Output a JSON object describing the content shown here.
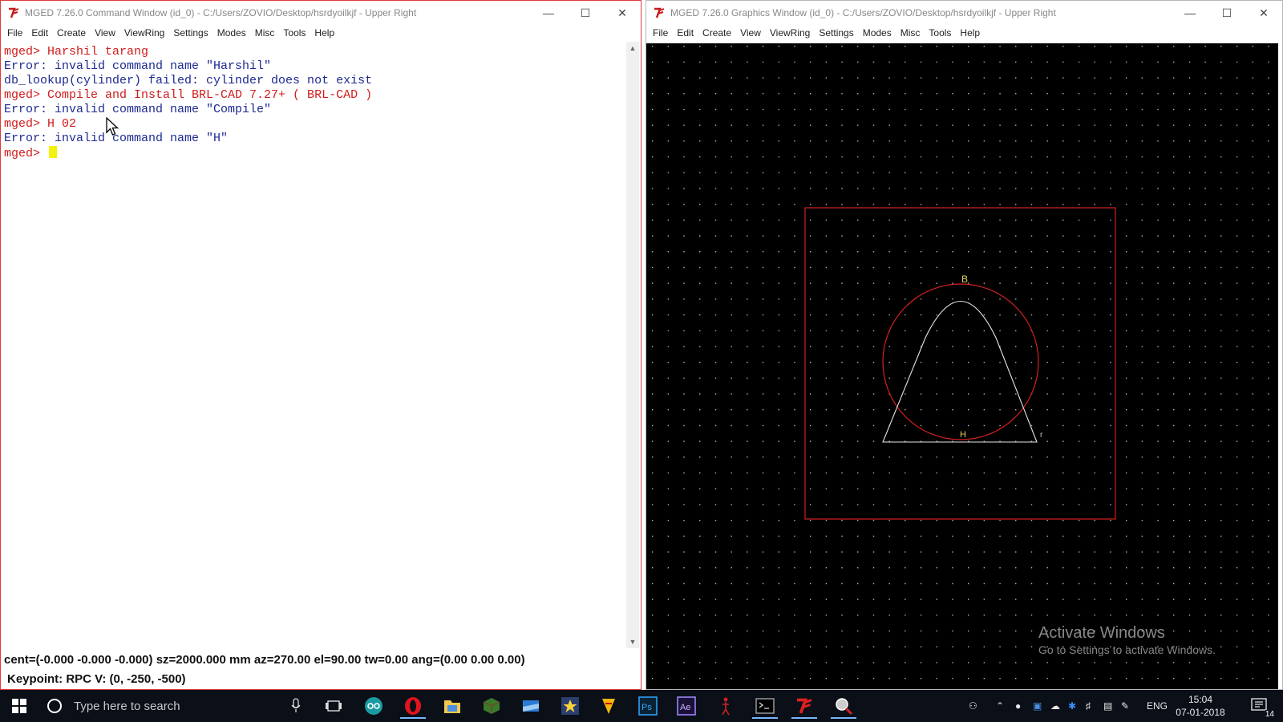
{
  "cmd_window": {
    "title": "MGED 7.26.0 Command Window (id_0) - C:/Users/ZOVIO/Desktop/hsrdyoilkjf - Upper Right",
    "menu": [
      "File",
      "Edit",
      "Create",
      "View",
      "ViewRing",
      "Settings",
      "Modes",
      "Misc",
      "Tools",
      "Help"
    ],
    "lines": [
      {
        "type": "prompt",
        "text": "mged> Harshil tarang"
      },
      {
        "type": "out",
        "text": "Error: invalid command name \"Harshil\""
      },
      {
        "type": "out",
        "text": "db_lookup(cylinder) failed: cylinder does not exist"
      },
      {
        "type": "prompt",
        "text": "mged> Compile and Install BRL-CAD 7.27+ ( BRL-CAD )"
      },
      {
        "type": "out",
        "text": "Error: invalid command name \"Compile\""
      },
      {
        "type": "prompt",
        "text": "mged> H 02"
      },
      {
        "type": "out",
        "text": "Error: invalid command name \"H\""
      }
    ],
    "current_prompt": "mged> ",
    "status_line1": "cent=(-0.000 -0.000 -0.000) sz=2000.000  mm  az=270.00  el=90.00  tw=0.00  ang=(0.00 0.00 0.00)",
    "status_line2": "Keypoint: RPC V: (0, -250, -500)"
  },
  "gfx_window": {
    "title": "MGED 7.26.0 Graphics Window (id_0) - C:/Users/ZOVIO/Desktop/hsrdyoilkjf - Upper Right",
    "menu": [
      "File",
      "Edit",
      "Create",
      "View",
      "ViewRing",
      "Settings",
      "Modes",
      "Misc",
      "Tools",
      "Help"
    ],
    "labels": {
      "top": "B",
      "center": "H",
      "right": "r"
    }
  },
  "watermark": {
    "title": "Activate Windows",
    "subtitle": "Go to Settings to activate Windows."
  },
  "taskbar": {
    "search_placeholder": "Type here to search",
    "language": "ENG",
    "time": "15:04",
    "date": "07-01-2018",
    "notification_count": "14"
  },
  "colors": {
    "accent_red": "#d01c1c",
    "output_blue": "#1d2a92",
    "cursor_yellow": "#f2f20a",
    "grid_dot": "#cfcfcf"
  }
}
